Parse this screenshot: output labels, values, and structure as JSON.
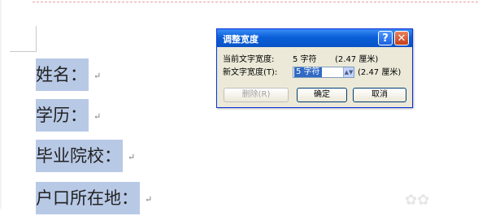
{
  "document": {
    "lines": [
      {
        "text": "姓名：",
        "mark": "↵"
      },
      {
        "text": "学历：",
        "mark": "↵"
      },
      {
        "text": "毕业院校：",
        "mark": "↵"
      },
      {
        "text": "户口所在地：",
        "mark": "↵"
      }
    ]
  },
  "dialog": {
    "title": "调整宽度",
    "current_label": "当前文字宽度:",
    "current_value": "5 字符",
    "current_cm": "(2.47 厘米)",
    "new_label": "新文字宽度(T):",
    "new_value": "5 字符",
    "new_cm": "(2.47 厘米)",
    "delete_button": "删除(R)",
    "ok_button": "确定",
    "cancel_button": "取消"
  },
  "watermark": "✿✿"
}
